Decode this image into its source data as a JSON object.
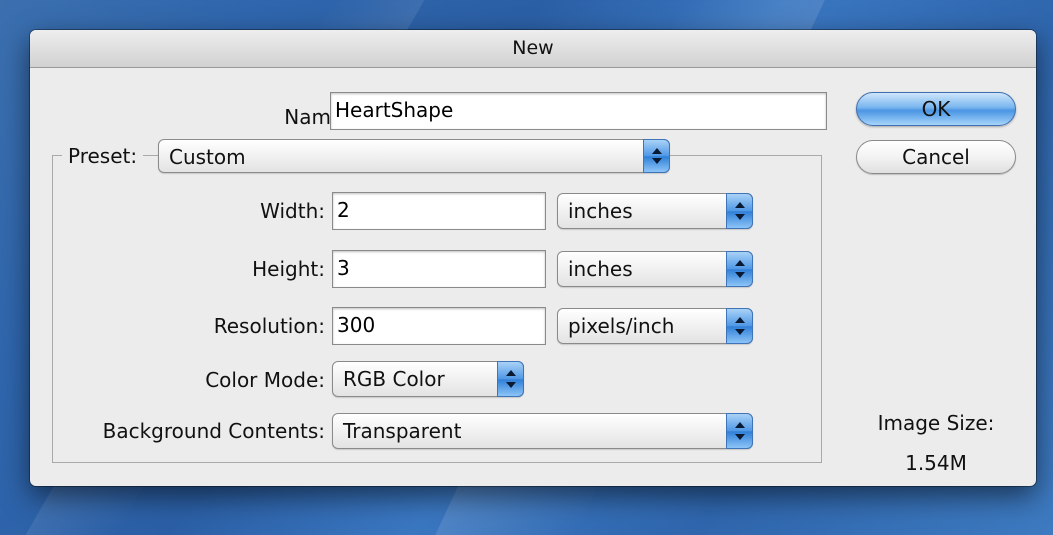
{
  "dialog": {
    "title": "New",
    "name": {
      "label": "Name:",
      "value": "HeartShape"
    },
    "preset": {
      "label": "Preset:",
      "value": "Custom"
    },
    "width": {
      "label": "Width:",
      "value": "2",
      "unit": "inches"
    },
    "height": {
      "label": "Height:",
      "value": "3",
      "unit": "inches"
    },
    "resolution": {
      "label": "Resolution:",
      "value": "300",
      "unit": "pixels/inch"
    },
    "color_mode": {
      "label": "Color Mode:",
      "value": "RGB Color"
    },
    "background_contents": {
      "label": "Background Contents:",
      "value": "Transparent"
    },
    "buttons": {
      "ok": "OK",
      "cancel": "Cancel"
    },
    "image_size": {
      "label": "Image Size:",
      "value": "1.54M"
    }
  },
  "colors": {
    "desktop": "#2f66ad",
    "dialog_bg": "#ececec",
    "aqua_blue": "#4f97e6"
  },
  "icons": [
    "stepper-arrows-icon"
  ]
}
